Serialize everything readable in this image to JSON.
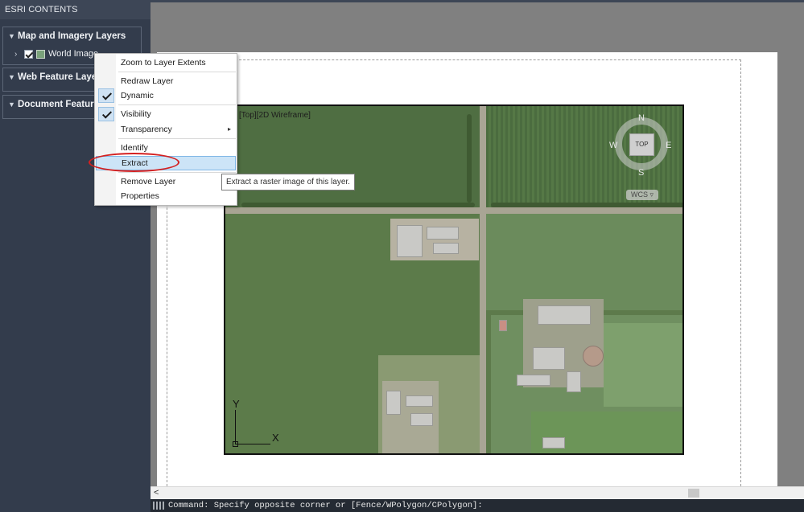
{
  "panel": {
    "title": "ESRI CONTENTS",
    "groups": [
      {
        "label": "Map and Imagery Layers",
        "layer": "World Image"
      },
      {
        "label": "Web Feature Layers"
      },
      {
        "label": "Document Feature"
      }
    ]
  },
  "viewport": {
    "label": "[Top][2D Wireframe]",
    "viewcube": {
      "north": "N",
      "south": "S",
      "east": "E",
      "west": "W",
      "face": "TOP",
      "wcs": "WCS"
    },
    "ucs": {
      "x": "X",
      "y": "Y"
    }
  },
  "context_menu": {
    "items": [
      {
        "label": "Zoom to Layer Extents"
      },
      {
        "label": "Redraw Layer"
      },
      {
        "label": "Dynamic",
        "checked": true
      },
      {
        "label": "Visibility",
        "checked": true
      },
      {
        "label": "Transparency",
        "submenu": true
      },
      {
        "label": "Identify"
      },
      {
        "label": "Extract",
        "highlighted": true
      },
      {
        "label": "Remove Layer"
      },
      {
        "label": "Properties"
      }
    ],
    "submenu_arrow": "▸"
  },
  "tooltip": {
    "text": "Extract a raster image of this layer."
  },
  "scrollbar": {
    "left_arrow": "<"
  },
  "command_line": {
    "text": "Command: Specify opposite corner or [Fence/WPolygon/CPolygon]:"
  },
  "colors": {
    "highlight": "#cce4f7",
    "annotation_oval": "#d42020"
  }
}
